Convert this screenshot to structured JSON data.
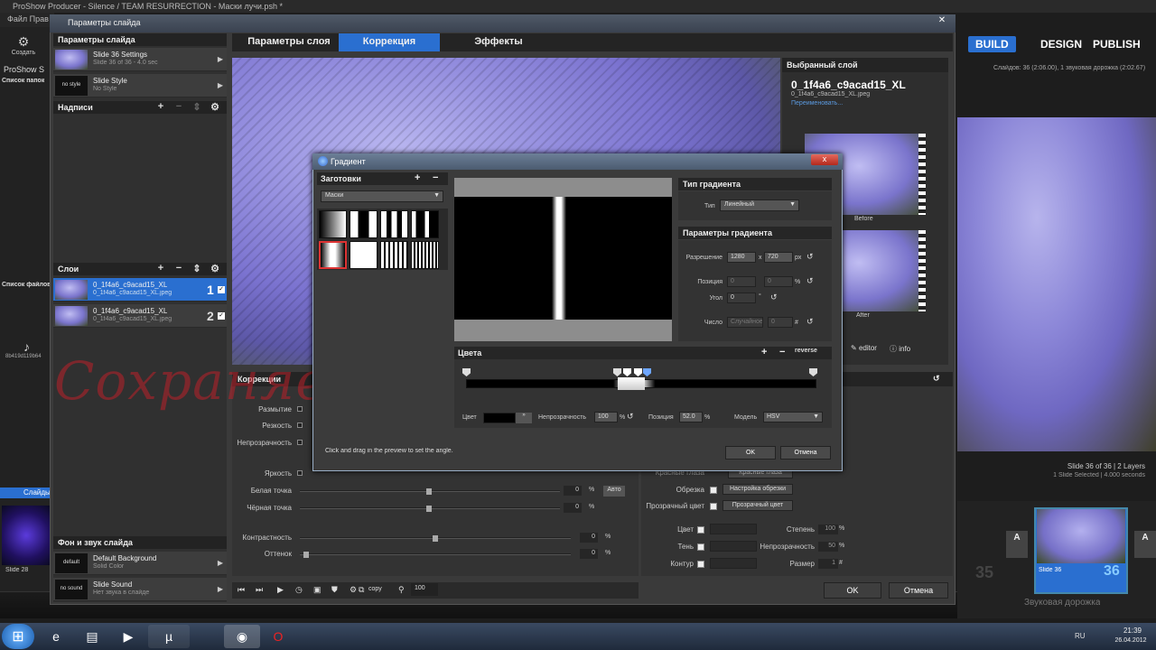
{
  "app": {
    "title": "ProShow Producer - Silence / TEAM RESURRECTION - Маски лучи.psh *",
    "menu_file": "Файл",
    "menu_edit": "Прав",
    "create_label": "Создать",
    "proshow_label": "ProShow S",
    "folders_label": "Список папок",
    "files_label": "Список файлов",
    "file_item": "8b419d119b64",
    "slides_tab": "Слайды",
    "slide28": "Slide 28",
    "modes": {
      "build": "BUILD",
      "design": "DESIGN",
      "publish": "PUBLISH"
    },
    "status": "Слайдов: 36 (2:06.00), 1 звуковая дорожка (2:02.67)",
    "slide_info": "Slide 36 of 36 | 2 Layers",
    "slide_info2": "1 Slide Selected | 4.000 seconds",
    "timeline_num35": "35",
    "timeline_slide36": "Slide 36",
    "timeline_num36": "36",
    "sound_track": "Звуковая дорожка",
    "a_label": "A",
    "taskbar_lang": "RU",
    "taskbar_time": "21:39",
    "taskbar_date": "26.04.2012",
    "accent": "#2a6fd0"
  },
  "slide_window": {
    "title": "Параметры слайда",
    "close": "✕",
    "slide_params_head": "Параметры слайда",
    "settings_title": "Slide 36 Settings",
    "settings_sub": "Slide 36 of 36 - 4.0 sec",
    "style_thumb": "no style",
    "style_title": "Slide Style",
    "style_sub": "No Style",
    "captions_head": "Надписи",
    "layers_head": "Слои",
    "layers": [
      {
        "title": "0_1f4a6_c9acad15_XL",
        "sub": "0_1f4a6_c9acad15_XL.jpeg",
        "num": "1"
      },
      {
        "title": "0_1f4a6_c9acad15_XL",
        "sub": "0_1f4a6_c9acad15_XL.jpeg",
        "num": "2"
      }
    ],
    "bg_sound_head": "Фон и звук слайда",
    "bg_thumb": "default",
    "bg_title": "Default Background",
    "bg_sub": "Solid Color",
    "sound_thumb": "no sound",
    "sound_title": "Slide Sound",
    "sound_sub": "Нет звука в слайде",
    "tabs": [
      "Параметры слоя",
      "Коррекция",
      "Эффекты"
    ],
    "selected_layer_head": "Выбранный слой",
    "selected_layer_name": "0_1f4a6_c9acad15_XL",
    "selected_layer_file": "0_1f4a6_c9acad15_XL.jpeg",
    "rename": "Переименовать...",
    "before": "Before",
    "after": "After",
    "editor": "editor",
    "info": "info",
    "corrections_head": "Коррекции",
    "corr_labels": {
      "blur": "Размытие",
      "sharp": "Резкость",
      "opacity": "Непрозрачность",
      "brightness": "Яркость",
      "white": "Белая точка",
      "black": "Чёрная точка",
      "contrast": "Контрастность",
      "hue": "Оттенок"
    },
    "corr_values": {
      "white": "0",
      "black": "0",
      "contrast": "0",
      "hue": "0"
    },
    "pct": "%",
    "auto": "Авто",
    "right_labels": {
      "red_eye": "Красные глаза",
      "crop": "Обрезка",
      "crop_btn": "Настройка обрезки",
      "transparent": "Прозрачный цвет",
      "transparent_btn": "Прозрачный цвет",
      "color": "Цвет",
      "shade": "Тень",
      "outline": "Контур",
      "strength": "Степень",
      "opacity": "Непрозрачность",
      "size": "Размер"
    },
    "right_values": {
      "strength": "100",
      "opacity": "50",
      "size": "1"
    },
    "hash": "#",
    "copy": "copy",
    "zoom": "100",
    "ok": "OK",
    "cancel": "Отмена"
  },
  "watermark": "Сохраняем изменения -",
  "gradient_dialog": {
    "title": "Градиент",
    "close": "x",
    "presets_head": "Заготовки",
    "presets_select": "Маски",
    "plus": "+",
    "minus": "−",
    "gtype_head": "Тип градиента",
    "gtype_label": "Тип",
    "gtype_value": "Линейный",
    "gparams_head": "Параметры градиента",
    "resolution_label": "Разрешение",
    "res_w": "1280",
    "x": "x",
    "res_h": "720",
    "px": "px",
    "position_label": "Позиция",
    "pos_x": "0",
    "pos_y": "0",
    "pct": "%",
    "angle_label": "Угол",
    "angle": "0",
    "deg": "°",
    "number_label": "Число",
    "random": "Случайное",
    "number_val": "0",
    "hash": "#",
    "colors_head": "Цвета",
    "reverse": "reverse",
    "color_label": "Цвет",
    "opacity_label": "Непрозрачность",
    "opacity_val": "100",
    "position2_label": "Позиция",
    "position2_val": "52.0",
    "model_label": "Модель",
    "model_val": "HSV",
    "hint": "Click and drag in the preview to set the angle.",
    "ok": "OK",
    "cancel": "Отмена"
  }
}
